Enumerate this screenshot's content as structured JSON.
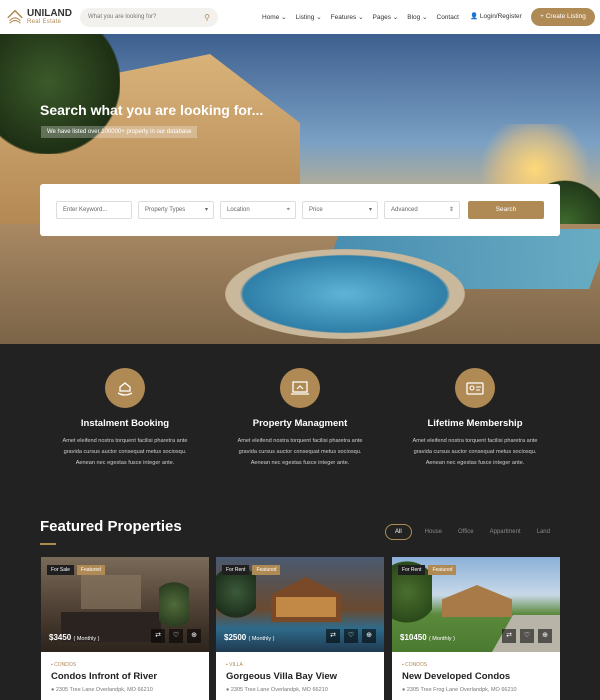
{
  "header": {
    "logo_name": "UNILAND",
    "logo_tagline": "Real Estate",
    "search_placeholder": "What you are looking for?",
    "nav": [
      "Home ⌄",
      "Listing ⌄",
      "Features ⌄",
      "Pages ⌄",
      "Blog ⌄",
      "Contact"
    ],
    "login": "Login/Register",
    "cta": "+ Create Listing"
  },
  "hero": {
    "title": "Search what you are looking for...",
    "subtitle": "We have listed over 100000+ property in our database",
    "fields": {
      "keyword": "Enter Keyword...",
      "type": "Property Types",
      "location": "Location",
      "price": "Price",
      "advanced": "Advanced"
    },
    "search_button": "Search"
  },
  "features": [
    {
      "title": "Instalment Booking",
      "icon": "hand-house-icon",
      "desc": [
        "Amet eleifend nostra torquent facilisi pharetra ante",
        "gravida cursus auctor consequat metus sociosqu.",
        "Aenean nec egestas fusce integer ante."
      ]
    },
    {
      "title": "Property Managment",
      "icon": "laptop-house-icon",
      "desc": [
        "Amet eleifend nostra torquent facilisi pharetra ante",
        "gravida cursus auctor consequat metus sociosqu.",
        "Aenean nec egestas fusce integer ante."
      ]
    },
    {
      "title": "Lifetime Membership",
      "icon": "id-card-icon",
      "desc": [
        "Amet eleifend nostra torquent facilisi pharetra ante",
        "gravida cursus auctor consequat metus sociosqu.",
        "Aenean nec egestas fusce integer ante."
      ]
    }
  ],
  "featured": {
    "title": "Featured Properties",
    "filters": [
      "All",
      "House",
      "Office",
      "Appartment",
      "Land"
    ]
  },
  "cards": [
    {
      "tag1": "For Sale",
      "tag2": "Featured",
      "price": "$3450",
      "period": "( Monthly )",
      "type": "CONDOS",
      "name": "Condos Infront of River",
      "address": "2305 Tree Lane Overlandpk, MO 66210"
    },
    {
      "tag1": "For Rent",
      "tag2": "Featured",
      "price": "$2500",
      "period": "( Monthly )",
      "type": "VILLA",
      "name": "Gorgeous Villa Bay View",
      "address": "2305 Tree Lane Overlandpk, MO 66210"
    },
    {
      "tag1": "For Rent",
      "tag2": "Featured",
      "price": "$10450",
      "period": "( Monthly )",
      "type": "CONDOS",
      "name": "New Developed Condos",
      "address": "2305 Tree Frog Lane Overlandpk, MO 66210"
    }
  ],
  "colors": {
    "accent": "#b08a55",
    "dark": "#222222"
  }
}
